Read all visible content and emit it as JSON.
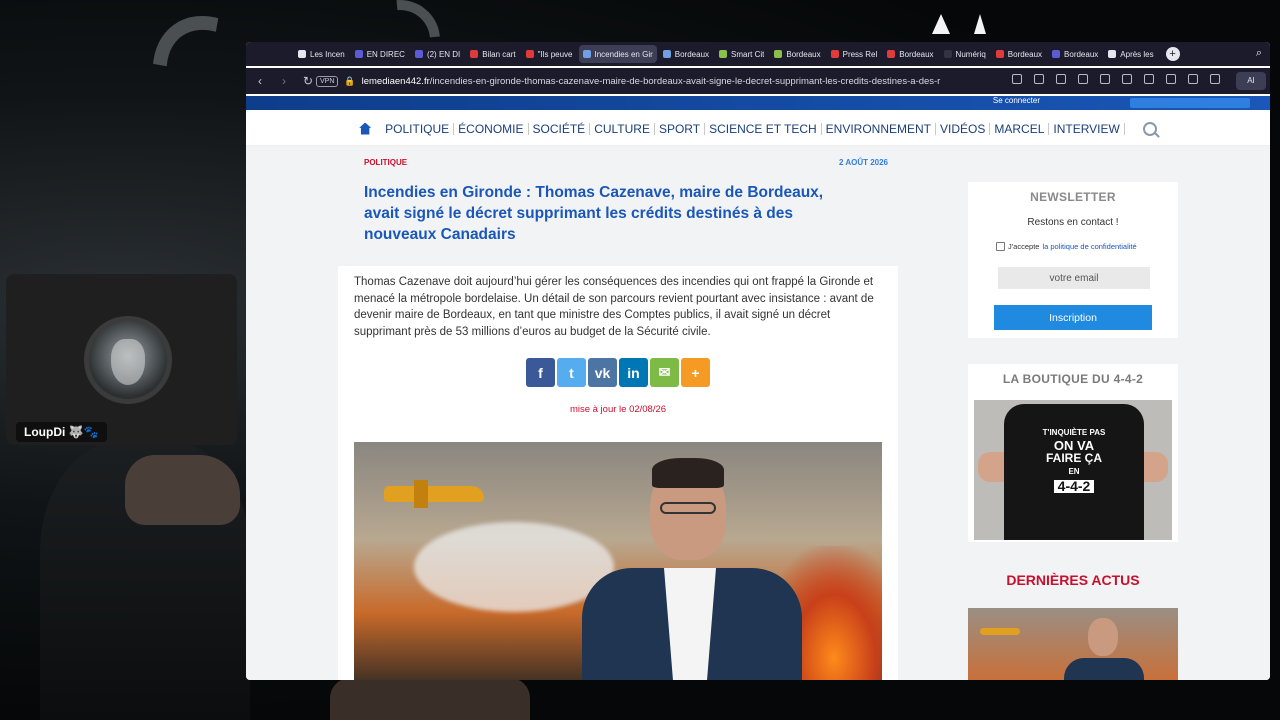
{
  "webcam": {
    "name": "LoupDi 🐺🐾"
  },
  "browser": {
    "tabs": [
      {
        "label": "Les Incen",
        "color": "#e6e6ee"
      },
      {
        "label": "EN DIREC",
        "color": "#5b5bd6"
      },
      {
        "label": "(2) EN DI",
        "color": "#5b5bd6"
      },
      {
        "label": "Bilan cart",
        "color": "#e03b3b"
      },
      {
        "label": "\"Ils peuve",
        "color": "#e03b3b"
      },
      {
        "label": "Incendies en Gir",
        "color": "#6fa0e6",
        "active": true
      },
      {
        "label": "Bordeaux",
        "color": "#6fa0e6"
      },
      {
        "label": "Smart Cit",
        "color": "#8ac04a"
      },
      {
        "label": "Bordeaux",
        "color": "#8ac04a"
      },
      {
        "label": "Press Rel",
        "color": "#e03b3b"
      },
      {
        "label": "Bordeaux",
        "color": "#e03b3b"
      },
      {
        "label": "Numériq",
        "color": "#333344"
      },
      {
        "label": "Bordeaux",
        "color": "#e03b3b"
      },
      {
        "label": "Bordeaux",
        "color": "#5b5bd6"
      },
      {
        "label": "Après les",
        "color": "#e6e6ee"
      }
    ],
    "url_domain": "lemediaen442.fr",
    "url_path": "/incendies-en-gironde-thomas-cazenave-maire-de-bordeaux-avait-signe-le-decret-supprimant-les-credits-destines-a-des-r",
    "vpn_label": "VPN",
    "ai_label": "AI"
  },
  "site": {
    "topstrip_connect": "Se connecter",
    "menu": [
      "POLITIQUE",
      "ÉCONOMIE",
      "SOCIÉTÉ",
      "CULTURE",
      "SPORT",
      "SCIENCE ET TECH",
      "ENVIRONNEMENT",
      "VIDÉOS",
      "MARCEL",
      "INTERVIEW"
    ]
  },
  "article": {
    "category": "POLITIQUE",
    "date": "2 AOÛT 2026",
    "headline": "Incendies en Gironde : Thomas Cazenave, maire de Bordeaux, avait signé le décret supprimant les crédits destinés à des nouveaux Canadairs",
    "lead": "Thomas Cazenave doit aujourd’hui gérer les conséquences des incendies qui ont frappé la Gironde et menacé la métropole bordelaise. Un détail de son parcours revient pourtant avec insistance : avant de devenir maire de Bordeaux, en tant que ministre des Comptes publics, il avait signé un décret supprimant près de 53 millions d’euros au budget de la Sécurité civile.",
    "share": [
      {
        "glyph": "f",
        "color": "#3b5998",
        "name": "facebook"
      },
      {
        "glyph": "t",
        "color": "#55acee",
        "name": "twitter"
      },
      {
        "glyph": "vk",
        "color": "#4c75a3",
        "name": "vk"
      },
      {
        "glyph": "in",
        "color": "#0077b5",
        "name": "linkedin"
      },
      {
        "glyph": "✉",
        "color": "#7dbb46",
        "name": "email"
      },
      {
        "glyph": "+",
        "color": "#f59a22",
        "name": "more"
      }
    ],
    "updated": "mise à jour le 02/08/26"
  },
  "sidebar": {
    "newsletter_title": "NEWSLETTER",
    "newsletter_sub": "Restons en contact !",
    "consent_prefix": "J'accepte",
    "consent_link": "la politique de confidentialité",
    "email_placeholder": "votre email",
    "signup": "Inscription",
    "shop_title": "LA BOUTIQUE DU 4-4-2",
    "shirt_line1": "T'INQUIÈTE PAS",
    "shirt_line2": "ON VA",
    "shirt_line3": "FAIRE ÇA",
    "shirt_line4": "EN",
    "shirt_line5": "4-4-2",
    "latest_title": "DERNIÈRES ACTUS"
  }
}
